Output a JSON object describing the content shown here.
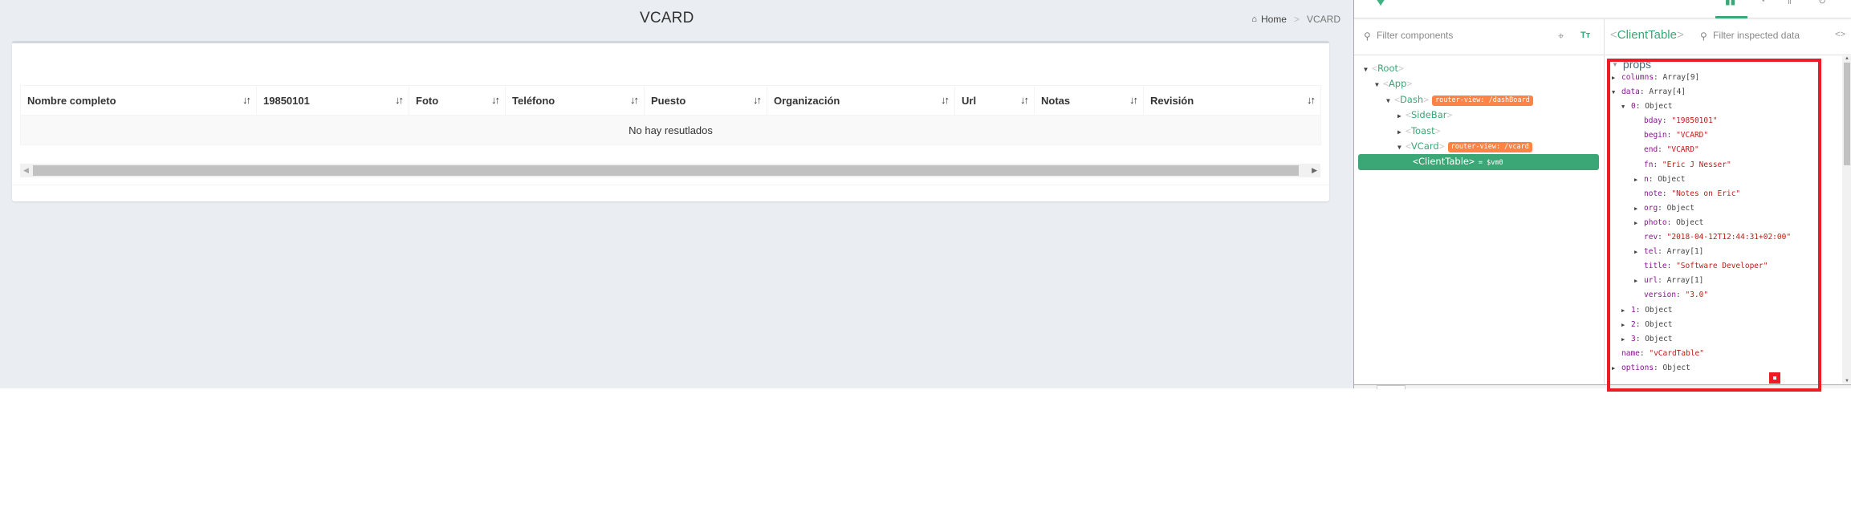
{
  "app": {
    "page_title": "VCARD",
    "breadcrumb": {
      "home": "Home",
      "separator": ">",
      "current": "VCARD"
    },
    "table": {
      "columns": [
        {
          "label": "Nombre completo",
          "sort_icon": "⇅"
        },
        {
          "label": "19850101",
          "sort_icon": "⇅"
        },
        {
          "label": "Foto",
          "sort_icon": "⇅"
        },
        {
          "label": "Teléfono",
          "sort_icon": "⇅"
        },
        {
          "label": "Puesto",
          "sort_icon": "⇅"
        },
        {
          "label": "Organización",
          "sort_icon": "⇅"
        },
        {
          "label": "Url",
          "sort_icon": "⇅"
        },
        {
          "label": "Notas",
          "sort_icon": "⇅"
        },
        {
          "label": "Revisión",
          "sort_icon": "⇅"
        }
      ],
      "empty_message": "No hay resutlados"
    }
  },
  "devtools": {
    "components_filter_placeholder": "Filter components",
    "inspected_filter_placeholder": "Filter inspected data",
    "inspected_component": "ClientTable",
    "tree": [
      {
        "name": "Root",
        "expanded": true
      },
      {
        "name": "App",
        "expanded": true
      },
      {
        "name": "Dash",
        "expanded": true,
        "badge": "router-view: /dashBoard"
      },
      {
        "name": "SideBar",
        "expanded": false
      },
      {
        "name": "Toast",
        "expanded": false
      },
      {
        "name": "VCard",
        "expanded": true,
        "badge": "router-view: /vcard"
      },
      {
        "name": "ClientTable",
        "selected": true,
        "vm": "= $vm0"
      }
    ],
    "props_section": "props",
    "props": [
      {
        "key": "columns",
        "value": "Array[9]",
        "kind": "type",
        "collapsible": "collapsed"
      },
      {
        "key": "data",
        "value": "Array[4]",
        "kind": "type",
        "collapsible": "expanded"
      },
      {
        "key": "0",
        "value": "Object",
        "kind": "type",
        "collapsible": "expanded"
      },
      {
        "key": "bday",
        "value": "\"19850101\"",
        "kind": "str"
      },
      {
        "key": "begin",
        "value": "\"VCARD\"",
        "kind": "str"
      },
      {
        "key": "end",
        "value": "\"VCARD\"",
        "kind": "str"
      },
      {
        "key": "fn",
        "value": "\"Eric J Nesser\"",
        "kind": "str"
      },
      {
        "key": "n",
        "value": "Object",
        "kind": "type",
        "collapsible": "collapsed"
      },
      {
        "key": "note",
        "value": "\"Notes on Eric\"",
        "kind": "str"
      },
      {
        "key": "org",
        "value": "Object",
        "kind": "type",
        "collapsible": "collapsed"
      },
      {
        "key": "photo",
        "value": "Object",
        "kind": "type",
        "collapsible": "collapsed"
      },
      {
        "key": "rev",
        "value": "\"2018-04-12T12:44:31+02:00\"",
        "kind": "str"
      },
      {
        "key": "tel",
        "value": "Array[1]",
        "kind": "type",
        "collapsible": "collapsed"
      },
      {
        "key": "title",
        "value": "\"Software Developer\"",
        "kind": "str"
      },
      {
        "key": "url",
        "value": "Array[1]",
        "kind": "type",
        "collapsible": "collapsed"
      },
      {
        "key": "version",
        "value": "\"3.0\"",
        "kind": "str"
      },
      {
        "key": "1",
        "value": "Object",
        "kind": "type",
        "collapsible": "collapsed"
      },
      {
        "key": "2",
        "value": "Object",
        "kind": "type",
        "collapsible": "collapsed"
      },
      {
        "key": "3",
        "value": "Object",
        "kind": "type",
        "collapsible": "collapsed"
      },
      {
        "key": "name",
        "value": "\"vCardTable\"",
        "kind": "str"
      },
      {
        "key": "options",
        "value": "Object",
        "kind": "type",
        "collapsible": "collapsed"
      }
    ],
    "colors": {
      "accent": "#3ba776",
      "badge": "#ff8344",
      "annotation": "#ed1c24"
    }
  }
}
